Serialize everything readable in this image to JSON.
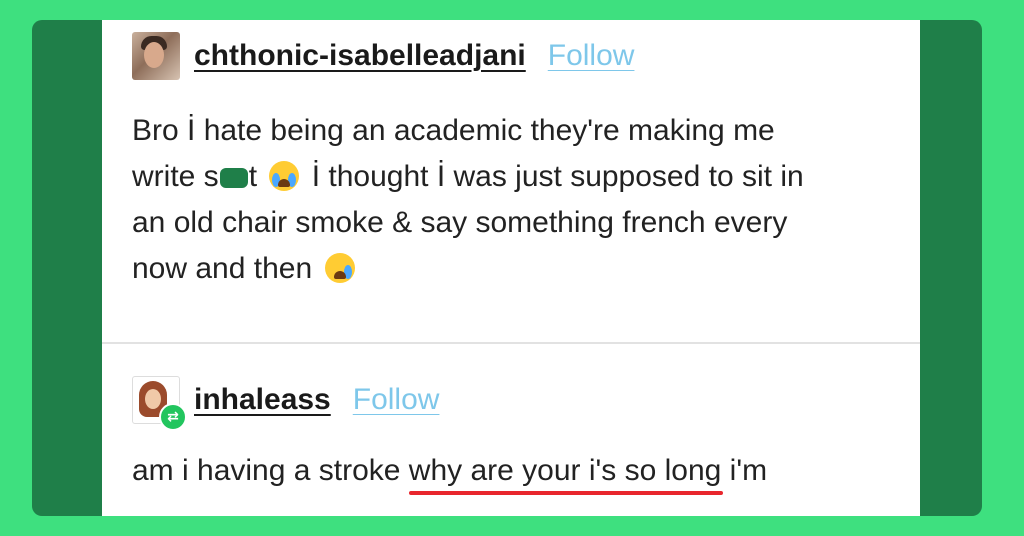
{
  "post1": {
    "username": "chthonic-isabelleadjani",
    "follow_label": "Follow",
    "body": {
      "line1": "Bro İ hate being an academic they're making me",
      "line2_a": "write s",
      "line2_b": "t",
      "line2_c": "İ thought İ was just supposed to sit in",
      "line3": "an old chair smoke & say something french every",
      "line4": "now and then"
    }
  },
  "post2": {
    "username": "inhaleass",
    "follow_label": "Follow",
    "reply_before": "am i having a stroke ",
    "reply_highlight": "why are your i's so long",
    "reply_after": " i'm"
  },
  "icons": {
    "emoji1": "loudly-crying-face",
    "emoji2": "crying-face",
    "reblog": "reblog-icon"
  },
  "colors": {
    "background": "#3ee07f",
    "frame": "#1f7f49",
    "follow": "#7ec7ea",
    "underline": "#e8262d"
  }
}
